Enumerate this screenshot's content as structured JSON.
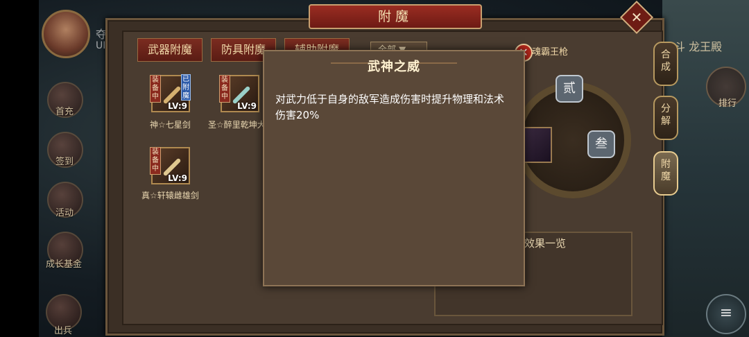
{
  "header": {
    "title": "附魔",
    "close_icon": "close-icon"
  },
  "player": {
    "name_partial": "夺义",
    "uid_label": "UID"
  },
  "left_menu": [
    {
      "label": "首充"
    },
    {
      "label": "签到"
    },
    {
      "label": "活动"
    },
    {
      "label": "成长基金"
    },
    {
      "label": "出兵"
    }
  ],
  "tabs": [
    {
      "label": "武器附魔"
    },
    {
      "label": "防具附魔"
    },
    {
      "label": "辅助附魔"
    }
  ],
  "filter": {
    "value": "全部"
  },
  "items": [
    {
      "name": "神☆七星剑",
      "level": "LV:9",
      "equipped_tag": "装备中",
      "enchanted_tag": "已附魔"
    },
    {
      "name": "圣☆醉里乾坤大",
      "level": "LV:9",
      "equipped_tag": "装备中",
      "enchanted_tag": ""
    },
    {
      "name": "真☆轩辕雌雄剑",
      "level": "LV:9",
      "equipped_tag": "装备中",
      "enchanted_tag": ""
    }
  ],
  "selected": {
    "name": "魂霸王枪",
    "slot_2": "贰",
    "slot_3": "叁"
  },
  "effects_panel": {
    "title": "效果一览"
  },
  "right_tabs": [
    {
      "label": "合\n成"
    },
    {
      "label": "分\n解"
    },
    {
      "label": "附\n魔"
    }
  ],
  "right_game": {
    "rank_label": "排行",
    "location": "斗 龙王殿",
    "menu_icon": "menu-icon"
  },
  "tooltip": {
    "title": "武神之威",
    "body": "对武力低于自身的敌军造成伤害时提升物理和法术伤害20%"
  }
}
